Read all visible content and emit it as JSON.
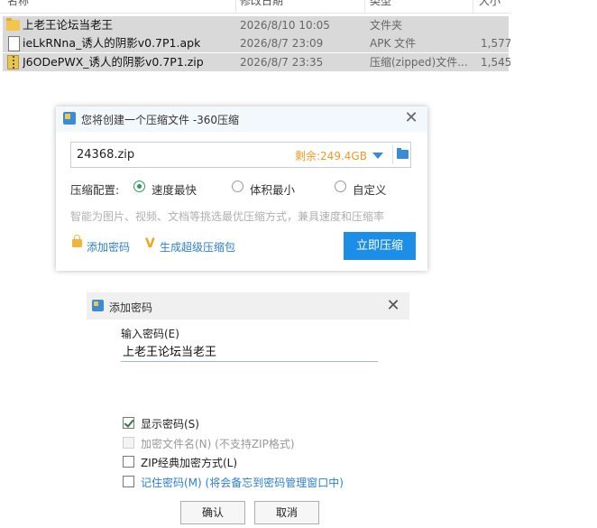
{
  "file_list": {
    "header": [
      "名称",
      "修改日期",
      "类型",
      "大小"
    ],
    "rows": [
      {
        "name": "上老王论坛当老王",
        "date": "2026/8/10 10:05",
        "type": "文件夹",
        "size": "",
        "icon": "folder-icon"
      },
      {
        "name": "ieLkRNna_诱人的阴影v0.7P1.apk",
        "date": "2026/8/7 23:09",
        "type": "APK 文件",
        "size": "1,577",
        "icon": "file-icon"
      },
      {
        "name": "J6ODePWX_诱人的阴影v0.7P1.zip",
        "date": "2026/8/7 23:35",
        "type": "压缩(zipped)文件...",
        "size": "1,545",
        "icon": "zip-icon"
      }
    ]
  },
  "compress_dialog": {
    "title": "您将创建一个压缩文件 -360压缩",
    "filename": "24368.zip",
    "free_space": "剩余:249.4GB",
    "config_label": "压缩配置:",
    "options": [
      "速度最快",
      "体积最小",
      "自定义"
    ],
    "selected_option": "速度最快",
    "hint": "智能为图片、视频、文档等挑选最优压缩方式，兼具速度和压缩率",
    "add_password_link": "添加密码",
    "super_package_link": "生成超级压缩包",
    "compress_button": "立即压缩",
    "close_glyph": "✕",
    "accent_color": "#1d8ee8"
  },
  "password_dialog": {
    "title": "添加密码",
    "input_label": "输入密码(E)",
    "password_value": "上老王论坛当老王",
    "show_password": {
      "label": "显示密码(S)",
      "checked": true
    },
    "encrypt_names": {
      "label": "加密文件名(N) (不支持ZIP格式)",
      "checked": false,
      "disabled": true
    },
    "zip_classic": {
      "label": "ZIP经典加密方式(L)",
      "checked": false
    },
    "remember": {
      "label": "记住密码(M) (将会备忘到密码管理窗口中)",
      "checked": false
    },
    "ok_button": "确认",
    "cancel_button": "取消",
    "close_glyph": "✕"
  }
}
